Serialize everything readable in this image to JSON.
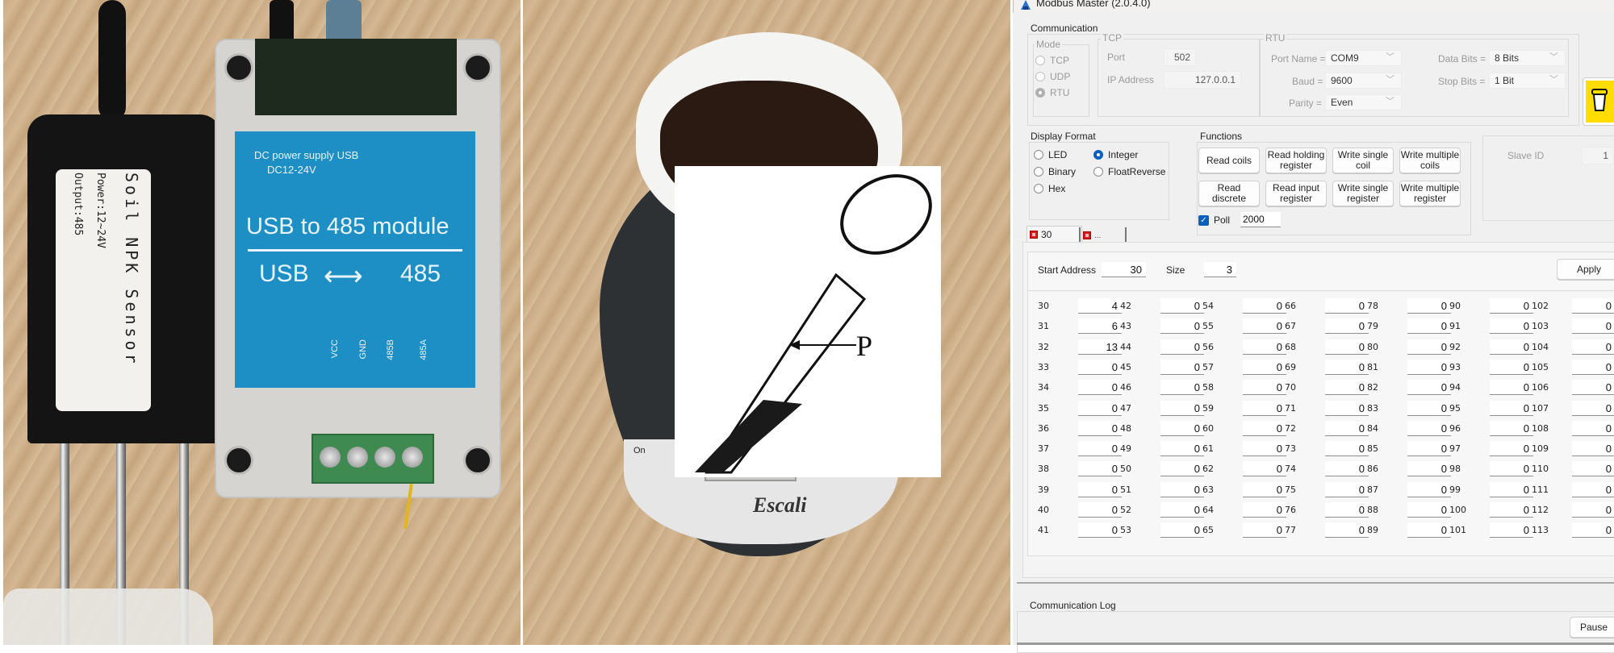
{
  "photo_left": {
    "sensor_label": {
      "title": "Soil NPK Sensor",
      "power": "Power:12~24V",
      "output": "Output:485"
    },
    "module_label": {
      "dc_supply": "DC power supply  USB",
      "dc_range": "DC12-24V",
      "title": "USB to 485 module",
      "usb": "USB",
      "rs485": "485",
      "pins": [
        "VCC",
        "GND",
        "485B",
        "485A"
      ]
    }
  },
  "photo_right": {
    "scale_brand": "Escali",
    "scale_button": "On",
    "figure_label": "P"
  },
  "app": {
    "title": "Modbus Master (2.0.4.0)",
    "communication": {
      "group_label": "Communication",
      "mode": {
        "label": "Mode",
        "options": [
          "TCP",
          "UDP",
          "RTU"
        ],
        "selected": "RTU"
      },
      "tcp": {
        "label": "TCP",
        "port_label": "Port",
        "port_value": "502",
        "ip_label": "IP Address",
        "ip_value": "127.0.0.1"
      },
      "rtu": {
        "label": "RTU",
        "port_name_label": "Port Name =",
        "port_name_value": "COM9",
        "baud_label": "Baud =",
        "baud_value": "9600",
        "parity_label": "Parity =",
        "parity_value": "Even",
        "data_bits_label": "Data Bits =",
        "data_bits_value": "8 Bits",
        "stop_bits_label": "Stop Bits =",
        "stop_bits_value": "1 Bit"
      }
    },
    "display_format": {
      "label": "Display Format",
      "options": [
        "LED",
        "Binary",
        "Hex",
        "Integer",
        "FloatReverse"
      ],
      "selected": "Integer"
    },
    "functions": {
      "label": "Functions",
      "buttons": [
        "Read coils",
        "Read holding register",
        "Write single coil",
        "Write multiple coils",
        "Read discrete",
        "Read input register",
        "Write single register",
        "Write multiple register"
      ],
      "poll_label": "Poll",
      "poll_checked": true,
      "poll_value": "2000"
    },
    "slave": {
      "label": "Slave ID",
      "value": "1"
    },
    "tabs": [
      {
        "label": "30"
      },
      {
        "label": "..."
      }
    ],
    "register_panel": {
      "start_address_label": "Start Address",
      "start_address_value": "30",
      "size_label": "Size",
      "size_value": "3",
      "apply_label": "Apply",
      "columns": [
        {
          "addresses": [
            30,
            31,
            32,
            33,
            34,
            35,
            36,
            37,
            38,
            39,
            40,
            41
          ],
          "values": [
            "4",
            "6",
            "13",
            "0",
            "0",
            "0",
            "0",
            "0",
            "0",
            "0",
            "0",
            "0"
          ]
        },
        {
          "addresses": [
            42,
            43,
            44,
            45,
            46,
            47,
            48,
            49,
            50,
            51,
            52,
            53
          ],
          "values": [
            "0",
            "0",
            "0",
            "0",
            "0",
            "0",
            "0",
            "0",
            "0",
            "0",
            "0",
            "0"
          ]
        },
        {
          "addresses": [
            54,
            55,
            56,
            57,
            58,
            59,
            60,
            61,
            62,
            63,
            64,
            65
          ],
          "values": [
            "0",
            "0",
            "0",
            "0",
            "0",
            "0",
            "0",
            "0",
            "0",
            "0",
            "0",
            "0"
          ]
        },
        {
          "addresses": [
            66,
            67,
            68,
            69,
            70,
            71,
            72,
            73,
            74,
            75,
            76,
            77
          ],
          "values": [
            "0",
            "0",
            "0",
            "0",
            "0",
            "0",
            "0",
            "0",
            "0",
            "0",
            "0",
            "0"
          ]
        },
        {
          "addresses": [
            78,
            79,
            80,
            81,
            82,
            83,
            84,
            85,
            86,
            87,
            88,
            89
          ],
          "values": [
            "0",
            "0",
            "0",
            "0",
            "0",
            "0",
            "0",
            "0",
            "0",
            "0",
            "0",
            "0"
          ]
        },
        {
          "addresses": [
            90,
            91,
            92,
            93,
            94,
            95,
            96,
            97,
            98,
            99,
            100,
            101
          ],
          "values": [
            "0",
            "0",
            "0",
            "0",
            "0",
            "0",
            "0",
            "0",
            "0",
            "0",
            "0",
            "0"
          ]
        },
        {
          "addresses": [
            102,
            103,
            104,
            105,
            106,
            107,
            108,
            109,
            110,
            111,
            112,
            113
          ],
          "values": [
            "0",
            "0",
            "0",
            "0",
            "0",
            "0",
            "0",
            "0",
            "0",
            "0",
            "0",
            "0"
          ]
        }
      ]
    },
    "communication_log": {
      "label": "Communication Log",
      "pause_label": "Pause"
    }
  }
}
